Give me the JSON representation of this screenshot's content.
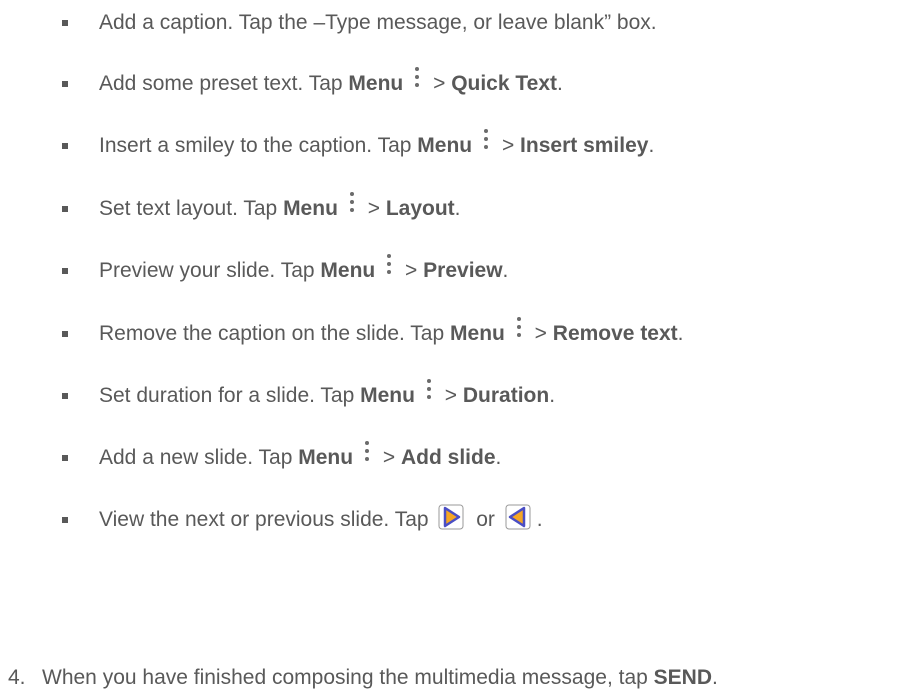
{
  "bullets": [
    {
      "t1": "Add a caption. Tap the –Type message, or leave blank” box."
    },
    {
      "t1": "Add some preset text. Tap ",
      "menu": "Menu",
      "sep": " > ",
      "target": "Quick Text",
      "end": "."
    },
    {
      "t1": "Insert a smiley to the caption. Tap ",
      "menu": "Menu",
      "sep": " > ",
      "target": "Insert smiley",
      "end": "."
    },
    {
      "t1": "Set text layout. Tap ",
      "menu": "Menu",
      "sep": " > ",
      "target": "Layout",
      "end": "."
    },
    {
      "t1": "Preview your slide. Tap ",
      "menu": "Menu",
      "sep": " > ",
      "target": "Preview",
      "end": "."
    },
    {
      "t1": "Remove the caption on the slide. Tap ",
      "menu": "Menu",
      "sep": " > ",
      "target": "Remove text",
      "end": "."
    },
    {
      "t1": "Set duration for a slide. Tap ",
      "menu": "Menu",
      "sep": " > ",
      "target": "Duration",
      "end": "."
    },
    {
      "t1": "Add a new slide. Tap ",
      "menu": "Menu",
      "sep": " > ",
      "target": "Add slide",
      "end": "."
    },
    {
      "t1": "View the next or previous slide. Tap ",
      "or": " or ",
      "end": "."
    }
  ],
  "step4": {
    "number": "4.",
    "text": "When you have finished composing the multimedia message, tap ",
    "action": "SEND",
    "end": "."
  },
  "icons": {
    "menu": "menu-overflow-icon",
    "next": "next-slide-icon",
    "previous": "previous-slide-icon"
  },
  "colors": {
    "text": "#595959",
    "nav_icon_fill": "#f5a623",
    "nav_icon_stroke": "#4a4ec4"
  }
}
